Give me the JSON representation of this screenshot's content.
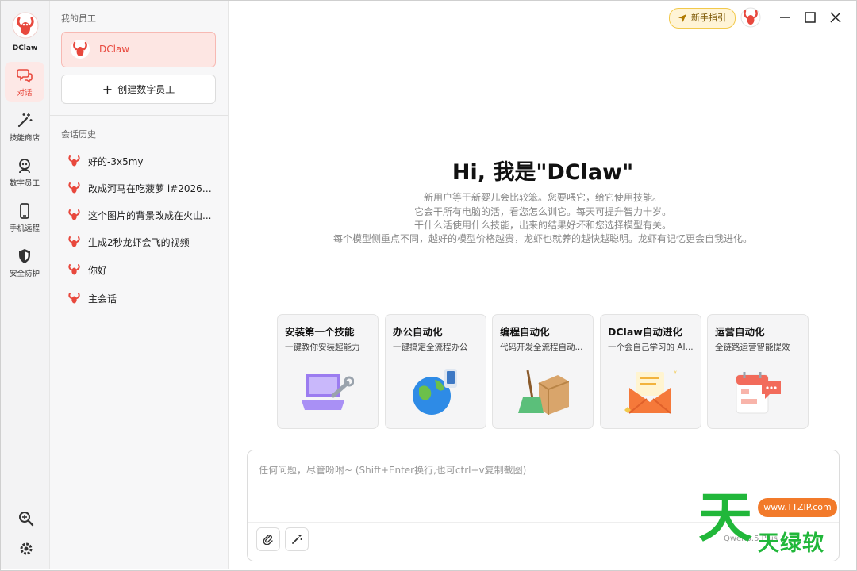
{
  "app": {
    "name": "DClaw"
  },
  "colors": {
    "accent": "#e8483d",
    "active_bg": "#fde8e6",
    "guide_bg": "#fff4d6",
    "watermark_green": "#21b73a",
    "watermark_orange": "#f27a2a"
  },
  "rail": {
    "logo_label": "DClaw",
    "items": [
      {
        "label": "对话",
        "icon": "chat-icon",
        "active": true
      },
      {
        "label": "技能商店",
        "icon": "magic-wand-icon"
      },
      {
        "label": "数字员工",
        "icon": "robot-icon"
      },
      {
        "label": "手机远程",
        "icon": "phone-icon"
      },
      {
        "label": "安全防护",
        "icon": "shield-icon"
      }
    ],
    "bottom": [
      {
        "icon": "zoom-icon"
      },
      {
        "icon": "gear-icon"
      }
    ]
  },
  "sidebar": {
    "employees_title": "我的员工",
    "employee": {
      "name": "DClaw"
    },
    "create_label": "创建数字员工",
    "history_title": "会话历史",
    "history": [
      {
        "title": "好的-3x5my"
      },
      {
        "title": "改成河马在吃菠萝 i#2026041..."
      },
      {
        "title": "这个图片的背景改成在火山..."
      },
      {
        "title": "生成2秒龙虾会飞的视频"
      },
      {
        "title": "你好"
      },
      {
        "title": "主会话"
      }
    ]
  },
  "header": {
    "guide_label": "新手指引",
    "window_controls": [
      {
        "icon": "minimize-icon"
      },
      {
        "icon": "maximize-icon"
      },
      {
        "icon": "close-icon"
      }
    ]
  },
  "hero": {
    "title": "Hi, 我是\"DClaw\"",
    "lines": [
      "新用户等于新婴儿会比较笨。您要喂它，给它使用技能。",
      "它会干所有电脑的活，看您怎么训它。每天可提升智力十岁。",
      "干什么活使用什么技能，出来的结果好坏和您选择模型有关。",
      "每个模型侧重点不同，越好的模型价格越贵，龙虾也就养的越快越聪明。龙虾有记忆更会自我进化。"
    ]
  },
  "cards": [
    {
      "title": "安装第一个技能",
      "desc": "一键教你安装超能力",
      "icon": "laptop-wrench-icon"
    },
    {
      "title": "办公自动化",
      "desc": "一键搞定全流程办公",
      "icon": "globe-phone-icon"
    },
    {
      "title": "编程自动化",
      "desc": "代码开发全流程自动...",
      "icon": "broom-box-icon"
    },
    {
      "title": "DClaw自动进化",
      "desc": "一个会自己学习的 AI...",
      "icon": "envelope-icon"
    },
    {
      "title": "运营自动化",
      "desc": "全链路运营智能提效",
      "icon": "calendar-chat-icon"
    }
  ],
  "composer": {
    "placeholder": "任何问题，尽管吩咐~ (Shift+Enter换行,也可ctrl+v复制截图)",
    "attach_icon": "paperclip-icon",
    "skill_icon": "magic-wand-icon",
    "model_label": "Qwen3.5 Plus"
  },
  "watermark": {
    "char": "天",
    "url": "www.TTZIP.com",
    "text": "天绿软"
  }
}
